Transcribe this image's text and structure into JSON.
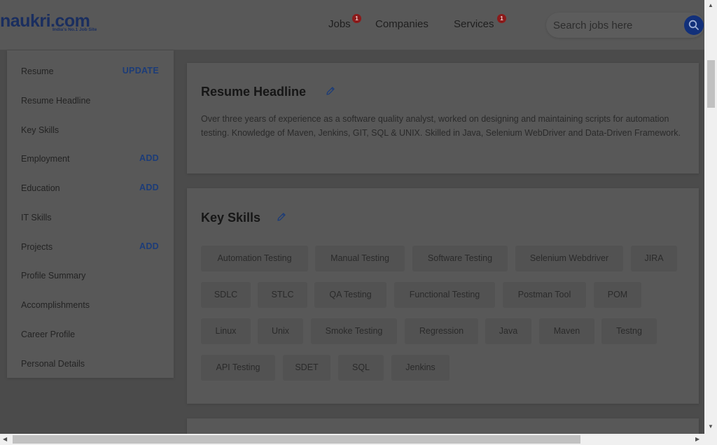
{
  "header": {
    "logo_text": "naukri.com",
    "logo_tagline": "India's No.1 Job Site",
    "nav": [
      {
        "label": "Jobs",
        "badge": "1"
      },
      {
        "label": "Companies"
      },
      {
        "label": "Services",
        "badge": "1"
      }
    ],
    "search_placeholder": "Search jobs here"
  },
  "sidebar": {
    "items": [
      {
        "label": "Resume",
        "action": "UPDATE"
      },
      {
        "label": "Resume Headline"
      },
      {
        "label": "Key Skills"
      },
      {
        "label": "Employment",
        "action": "ADD"
      },
      {
        "label": "Education",
        "action": "ADD"
      },
      {
        "label": "IT Skills"
      },
      {
        "label": "Projects",
        "action": "ADD"
      },
      {
        "label": "Profile Summary"
      },
      {
        "label": "Accomplishments"
      },
      {
        "label": "Career Profile"
      },
      {
        "label": "Personal Details"
      }
    ]
  },
  "resume_headline": {
    "title": "Resume Headline",
    "text": "Over three years of experience as a software quality analyst, worked on designing and maintaining scripts for automation testing. Knowledge of Maven, Jenkins, GIT, SQL & UNIX. Skilled in Java, Selenium WebDriver and Data-Driven Framework."
  },
  "key_skills": {
    "title": "Key Skills",
    "chips": [
      "Automation Testing",
      "Manual Testing",
      "Software Testing",
      "Selenium Webdriver",
      "JIRA",
      "SDLC",
      "STLC",
      "QA Testing",
      "Functional Testing",
      "Postman Tool",
      "POM",
      "Linux",
      "Unix",
      "Smoke Testing",
      "Regression",
      "Java",
      "Maven",
      "Testng",
      "API Testing",
      "SDET",
      "SQL",
      "Jenkins"
    ]
  },
  "icons": {
    "edit": "pencil-icon",
    "search": "search-icon"
  }
}
